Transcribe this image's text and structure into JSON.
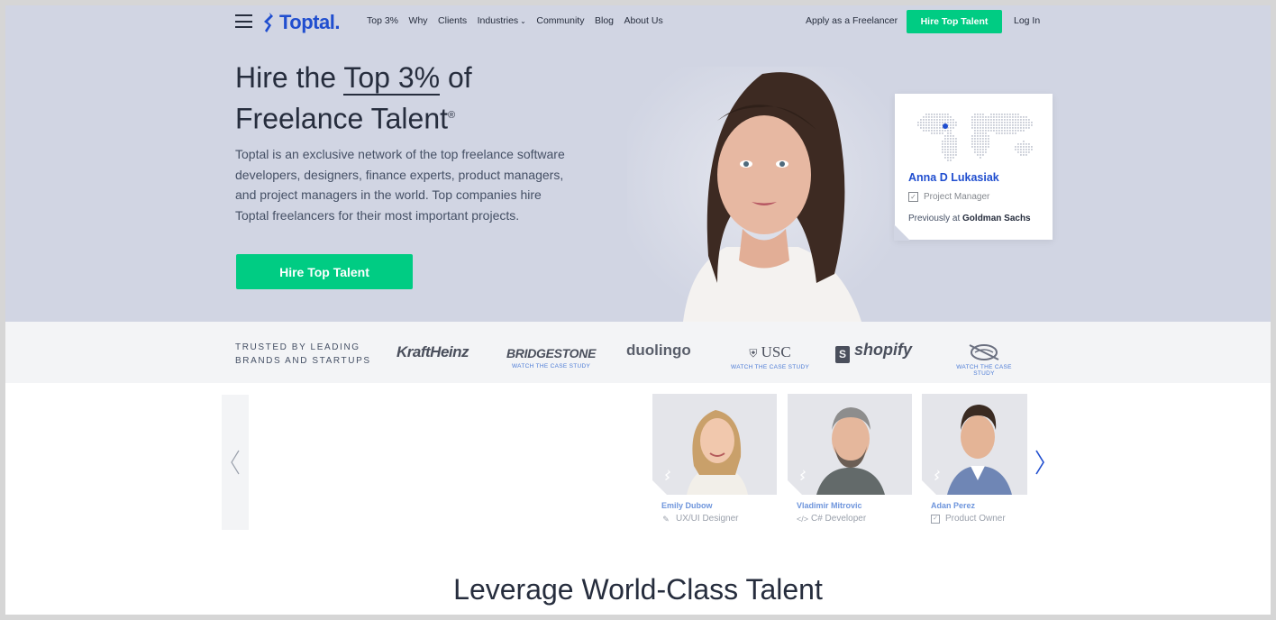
{
  "nav": {
    "logo_text": "Toptal",
    "links": [
      {
        "label": "Top 3%"
      },
      {
        "label": "Why"
      },
      {
        "label": "Clients"
      },
      {
        "label": "Industries",
        "has_dropdown": true
      },
      {
        "label": "Community"
      },
      {
        "label": "Blog"
      },
      {
        "label": "About Us"
      }
    ],
    "apply_label": "Apply as a Freelancer",
    "hire_label": "Hire Top Talent",
    "login_label": "Log In"
  },
  "hero": {
    "title_prefix": "Hire the ",
    "title_highlight": "Top 3%",
    "title_suffix": " of",
    "title_line2": "Freelance Talent",
    "title_mark": "®",
    "description": "Toptal is an exclusive network of the top freelance software developers, designers, finance experts, product managers, and project managers in the world. Top companies hire Toptal freelancers for their most important projects.",
    "cta_label": "Hire Top Talent",
    "profile": {
      "name": "Anna D Lukasiak",
      "role": "Project Manager",
      "previously_prefix": "Previously at ",
      "previously_company": "Goldman Sachs"
    }
  },
  "brands": {
    "trusted_line1": "TRUSTED BY LEADING",
    "trusted_line2": "BRANDS AND STARTUPS",
    "items": [
      {
        "name": "KraftHeinz",
        "case_study": ""
      },
      {
        "name": "BRIDGESTONE",
        "case_study": "WATCH THE CASE STUDY"
      },
      {
        "name": "duolingo",
        "case_study": ""
      },
      {
        "name": "USC",
        "case_study": "WATCH THE CASE STUDY"
      },
      {
        "name": "shopify",
        "case_study": ""
      },
      {
        "name": "Cavaliers",
        "case_study": "WATCH THE CASE STUDY"
      }
    ]
  },
  "talent": [
    {
      "name": "Emily Dubow",
      "role": "UX/UI Designer",
      "icon": "pen-tool-icon"
    },
    {
      "name": "Vladimir Mitrovic",
      "role": "C# Developer",
      "icon": "code-icon"
    },
    {
      "name": "Adan Perez",
      "role": "Product Owner",
      "icon": "checkbox-icon"
    }
  ],
  "section_title": "Leverage World-Class Talent",
  "colors": {
    "brand_blue": "#204ecf",
    "accent_green": "#00cc83",
    "hero_bg": "#d1d5e3",
    "text_dark": "#262d3d"
  }
}
